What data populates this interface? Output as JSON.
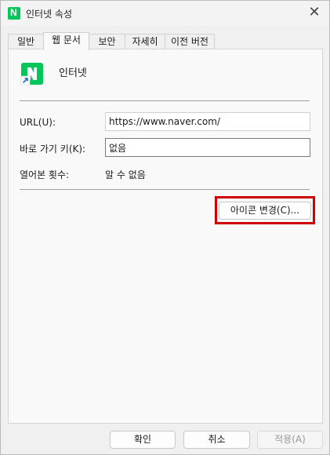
{
  "window": {
    "title": "인터넷 속성",
    "close_symbol": "✕",
    "logo_letter": "N"
  },
  "tabs": [
    {
      "label": "일반"
    },
    {
      "label": "웹 문서",
      "active": true
    },
    {
      "label": "보안"
    },
    {
      "label": "자세히"
    },
    {
      "label": "이전 버전"
    }
  ],
  "document": {
    "name": "인터넷",
    "icon": "naver-shortcut-icon",
    "url_label": "URL(U):",
    "url_value": "https://www.naver.com/",
    "shortcut_label": "바로 가기 키(K):",
    "shortcut_value": "없음",
    "visits_label": "열어본 횟수:",
    "visits_value": "알 수 없음",
    "change_icon_button": "아이콘 변경(C)..."
  },
  "footer": {
    "ok": "확인",
    "cancel": "취소",
    "apply": "적용(A)"
  },
  "colors": {
    "brand": "#03c75a",
    "highlight": "#d00000"
  }
}
